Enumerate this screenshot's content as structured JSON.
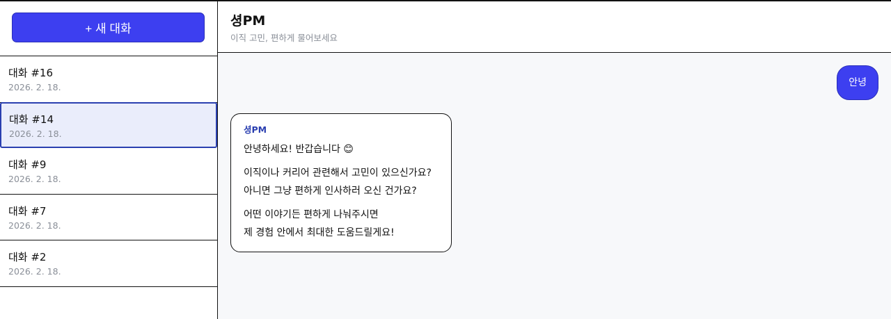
{
  "sidebar": {
    "new_chat_label": "+ 새 대화",
    "conversations": [
      {
        "title": "대화 #16",
        "date": "2026. 2. 18."
      },
      {
        "title": "대화 #14",
        "date": "2026. 2. 18."
      },
      {
        "title": "대화 #9",
        "date": "2026. 2. 18."
      },
      {
        "title": "대화 #7",
        "date": "2026. 2. 18."
      },
      {
        "title": "대화 #2",
        "date": "2026. 2. 18."
      }
    ]
  },
  "header": {
    "title": "셩PM",
    "subtitle": "이직 고민, 편하게 물어보세요"
  },
  "chat": {
    "user_message": "안녕",
    "bot_name": "셩PM",
    "bot_lines": {
      "p1": "안녕하세요! 반갑습니다 😊",
      "p2a": "이직이나 커리어 관련해서 고민이 있으신가요?",
      "p2b": "아니면 그냥 편하게 인사하러 오신 건가요?",
      "p3a": "어떤 이야기든 편하게 나눠주시면",
      "p3b": "제 경험 안에서 최대한 도움드릴게요!"
    }
  },
  "colors": {
    "accent": "#3d3ff0",
    "active_bg": "#eaedfb",
    "bot_name": "#2a3fb0"
  }
}
